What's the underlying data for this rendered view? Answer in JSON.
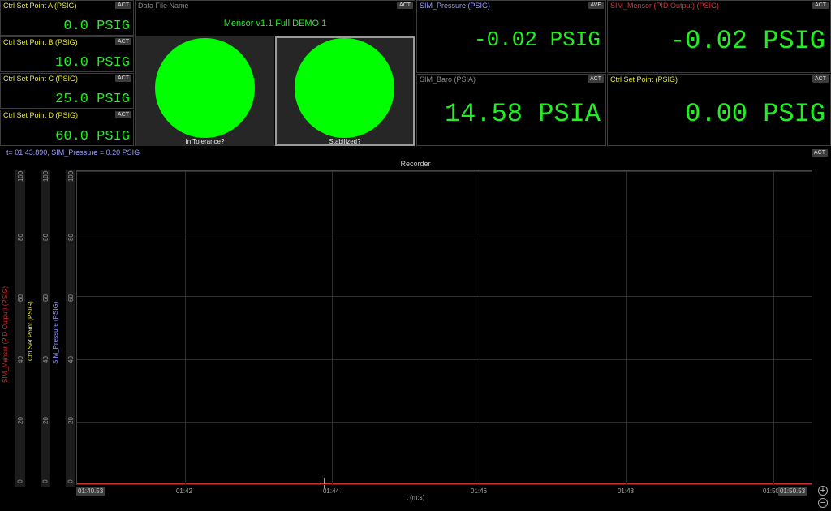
{
  "colors": {
    "green_value": "#22ee22",
    "lamp_green": "#00ff00",
    "yellow_label": "#e8e83a",
    "blue_label": "#9b9bff",
    "red_label": "#d13434",
    "grey_label": "#8a8a8a"
  },
  "set_points": [
    {
      "title": "Ctrl Set Point A (PSIG)",
      "badge": "ACT",
      "value": "0.0 PSIG"
    },
    {
      "title": "Ctrl Set Point B (PSIG)",
      "badge": "ACT",
      "value": "10.0 PSIG"
    },
    {
      "title": "Ctrl Set Point C (PSIG)",
      "badge": "ACT",
      "value": "25.0 PSIG"
    },
    {
      "title": "Ctrl Set Point D (PSIG)",
      "badge": "ACT",
      "value": "60.0 PSIG"
    }
  ],
  "data_file": {
    "title": "Data File Name",
    "badge": "ACT",
    "name": "Mensor v1.1 Full DEMO 1",
    "lamps": [
      {
        "label": "In Tolerance?",
        "state": "on",
        "color": "#00ff00"
      },
      {
        "label": "Stabilized?",
        "state": "on",
        "color": "#00ff00"
      }
    ]
  },
  "readouts": {
    "sim_pressure": {
      "title": "SIM_Pressure (PSIG)",
      "badge": "AVE",
      "value": "-0.02 PSIG"
    },
    "sim_mensor": {
      "title": "SIM_Mensor (PID Output) (PSIG)",
      "badge": "ACT",
      "value": "-0.02 PSIG"
    },
    "sim_baro": {
      "title": "SIM_Baro (PSIA)",
      "badge": "ACT",
      "value": "14.58 PSIA"
    },
    "ctrl_set_point": {
      "title": "Ctrl Set Point (PSIG)",
      "badge": "ACT",
      "value": "0.00 PSIG"
    }
  },
  "recorder": {
    "info": "t= 01:43.890, SIM_Pressure = 0.20 PSIG",
    "badge": "ACT",
    "title": "Recorder",
    "xlabel": "t (m:s)",
    "zoom_in": "+",
    "zoom_out": "−"
  },
  "chart_data": {
    "type": "line",
    "title": "Recorder",
    "xlabel": "t (m:s)",
    "x_ticks": [
      "01:40.53",
      "01:42",
      "01:44",
      "01:46",
      "01:48",
      "01:50",
      "01:50.53"
    ],
    "x_range": [
      "01:40.53",
      "01:50.53"
    ],
    "y_ticks": [
      "0",
      "20",
      "40",
      "60",
      "80",
      "100"
    ],
    "ylim": [
      0,
      100
    ],
    "grid": true,
    "axes": [
      {
        "name": "SIM_Mensor (PID Output) (PSIG)",
        "color": "#d13434"
      },
      {
        "name": "Ctrl Set Point (PSIG)",
        "color": "#e8e83a"
      },
      {
        "name": "SIM_Pressure (PSIG)",
        "color": "#9b9bff"
      }
    ],
    "series": [
      {
        "name": "SIM_Mensor (PID Output) (PSIG)",
        "color": "#d13434",
        "values": [
          0,
          0
        ]
      },
      {
        "name": "Ctrl Set Point (PSIG)",
        "color": "#e8e83a",
        "values": [
          0,
          0
        ]
      },
      {
        "name": "SIM_Pressure (PSIG)",
        "color": "#9b9bff",
        "values": [
          0,
          0
        ]
      }
    ],
    "cursor": {
      "x": "01:43.890",
      "y": 0.2
    }
  }
}
